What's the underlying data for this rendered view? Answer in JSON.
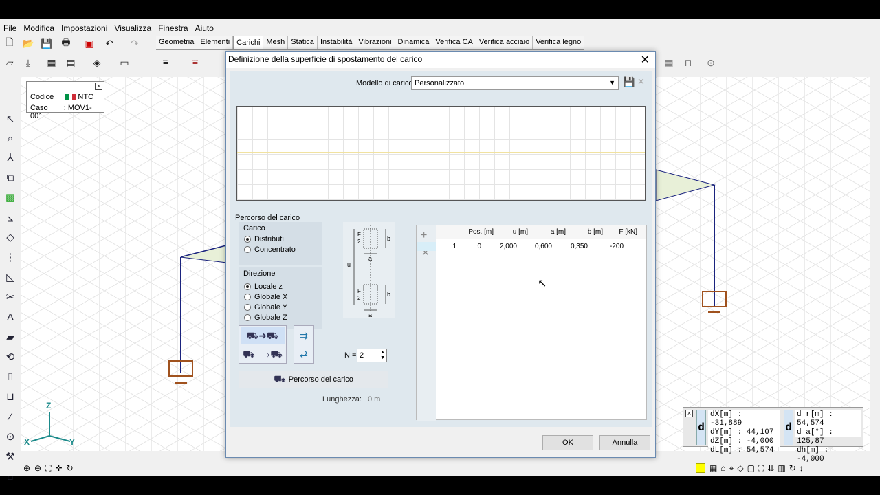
{
  "menu": [
    "File",
    "Modifica",
    "Impostazioni",
    "Visualizza",
    "Finestra",
    "Aiuto"
  ],
  "tabs": [
    "Geometria",
    "Elementi",
    "Carichi",
    "Mesh",
    "Statica",
    "Instabilità",
    "Vibrazioni",
    "Dinamica",
    "Verifica CA",
    "Verifica acciaio",
    "Verifica legno"
  ],
  "active_tab": "Carichi",
  "info": {
    "codice_label": "Codice",
    "codice_value": "NTC",
    "caso_label": "Caso",
    "caso_value": ": MOV1-001"
  },
  "axes": {
    "z": "Z",
    "x": "X",
    "y": "Y"
  },
  "dialog": {
    "title": "Definizione della superficie di spostamento del carico",
    "model_label": "Modello di carico",
    "model_value": "Personalizzato",
    "section_title": "Percorso del carico",
    "carico_title": "Carico",
    "carico_options": [
      "Distributi",
      "Concentrato"
    ],
    "carico_selected": 0,
    "direzione_title": "Direzione",
    "direzione_options": [
      "Locale z",
      "Globale X",
      "Globale Y",
      "Globale Z"
    ],
    "direzione_selected": 0,
    "diagram_labels": {
      "f": "F",
      "two": "2",
      "b": "b",
      "a": "a",
      "u": "u"
    },
    "n_label": "N =",
    "n_value": "2",
    "path_button": "Percorso del carico",
    "length_label": "Lunghezza:",
    "length_value": "0 m",
    "table": {
      "headers": [
        "Pos. [m]",
        "u [m]",
        "a [m]",
        "b [m]",
        "F [kN]"
      ],
      "rows": [
        {
          "n": "1",
          "pos": "0",
          "u": "2,000",
          "a": "0,600",
          "b": "0,350",
          "f": "-200"
        }
      ]
    },
    "ok": "OK",
    "cancel": "Annulla"
  },
  "coords": {
    "dx": "dX[m] : -31,889",
    "dy": "dY[m] : 44,107",
    "dz": "dZ[m] : -4,000",
    "dl": "dL[m] : 54,574",
    "dr": "d r[m] : 54,574",
    "da": "d a[°] : 125,87",
    "dh": "dh[m] : -4,000",
    "d": "d"
  },
  "colors": {
    "structure": "#1a237e",
    "accent": "#e8e8a0",
    "dialog_bg": "#dfe8ee"
  }
}
